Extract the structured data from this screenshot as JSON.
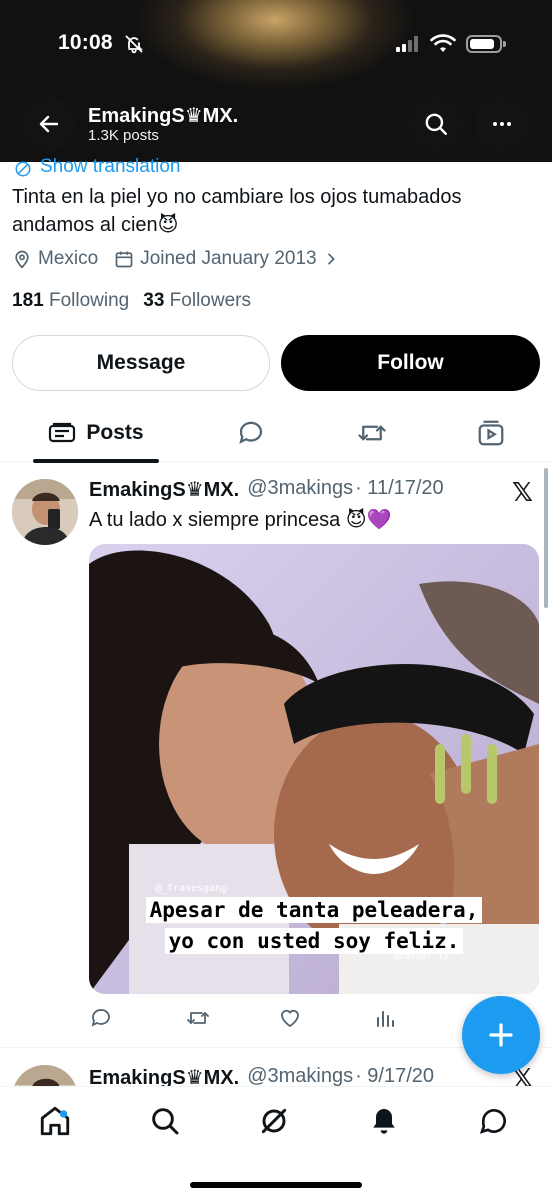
{
  "status_bar": {
    "time": "10:08"
  },
  "header": {
    "name": "EmakingS♛MX.",
    "posts_count": "1.3K posts"
  },
  "profile": {
    "show_translation": "Show translation",
    "bio": "Tinta en la piel yo no cambiare los ojos tumabados andamos al cien😈",
    "location": "Mexico",
    "joined": "Joined January 2013",
    "following_count": "181",
    "following_label": "Following",
    "followers_count": "33",
    "followers_label": "Followers",
    "message_label": "Message",
    "follow_label": "Follow"
  },
  "tabs": {
    "posts_label": "Posts"
  },
  "tweets": [
    {
      "name": "EmakingS♛MX.",
      "handle": "@3makings",
      "date": "· 11/17/20",
      "text": "A tu lado x siempre princesa 😈💜",
      "x_mark": "𝕏",
      "image": {
        "caption_line1": "Apesar de tanta peleadera,",
        "caption_line2": "yo con usted soy feliz.",
        "watermark_top": "@_frasesgang",
        "watermark_bottom": "@sakuul_13"
      }
    },
    {
      "name": "EmakingS♛MX.",
      "handle": "@3makings",
      "date": "· 9/17/20",
      "x_mark": "𝕏"
    }
  ],
  "icons": {
    "back": "arrow-left-icon",
    "search": "search-icon",
    "more": "more-icon",
    "location": "location-pin-icon",
    "calendar": "calendar-icon",
    "compose": "plus-icon"
  },
  "colors": {
    "accent": "#1d9bf0",
    "text": "#0f1419",
    "secondary": "#536471",
    "follow_bg": "#000000"
  }
}
